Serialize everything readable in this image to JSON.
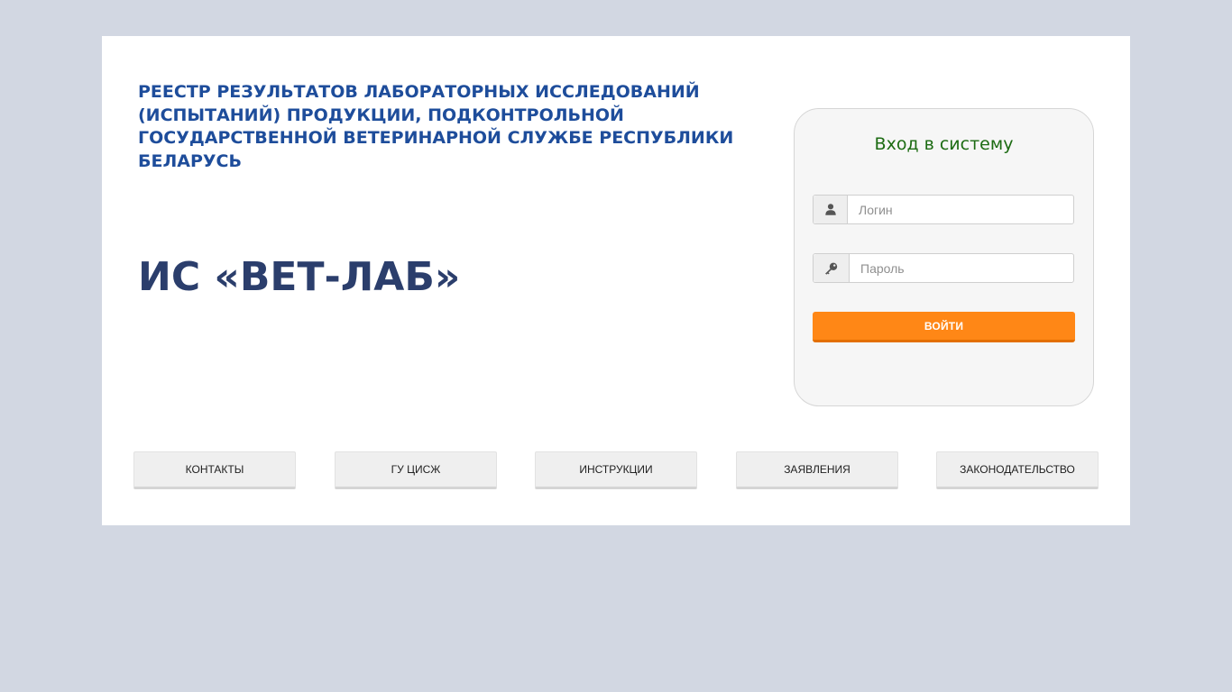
{
  "header": {
    "registry_title": "Реестр результатов лабораторных исследований (испытаний) продукции, подконтрольной государственной ветеринарной службе Республики Беларусь",
    "system_name": "ИС «ВЕТ-ЛАБ»"
  },
  "login": {
    "title": "Вход в систему",
    "username_placeholder": "Логин",
    "username_value": "",
    "password_placeholder": "Пароль",
    "password_value": "",
    "username_icon": "user-icon",
    "password_icon": "key-icon",
    "submit_label": "ВОЙТИ"
  },
  "nav": {
    "items": [
      {
        "label": "КОНТАКТЫ"
      },
      {
        "label": "ГУ ЦИСЖ"
      },
      {
        "label": "ИНСТРУКЦИИ"
      },
      {
        "label": "ЗАЯВЛЕНИЯ"
      },
      {
        "label": "ЗАКОНОДАТЕЛЬСТВО"
      }
    ]
  },
  "colors": {
    "page_background": "#d2d7e2",
    "title_blue": "#1e4d9b",
    "system_name": "#2b3e6c",
    "login_title_green": "#1c6b12",
    "accent_orange": "#ff8716"
  }
}
